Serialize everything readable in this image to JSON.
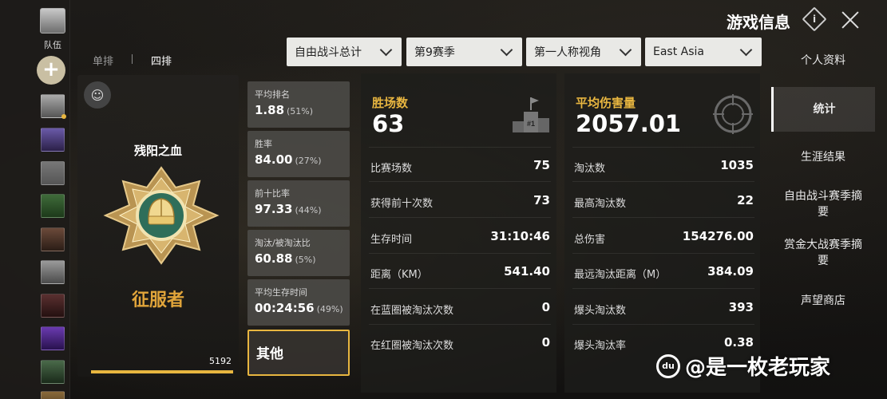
{
  "header": {
    "title": "游戏信息",
    "info_icon": "i",
    "close_icon": "close"
  },
  "left_column": {
    "team_label": "队伍",
    "add_label": "+"
  },
  "mode_tabs": [
    {
      "label": "单排",
      "active": false
    },
    {
      "label": "四排",
      "active": true
    }
  ],
  "filters": [
    {
      "value": "自由战斗总计"
    },
    {
      "value": "第9赛季"
    },
    {
      "value": "第一人称视角"
    },
    {
      "value": "East Asia"
    }
  ],
  "nav": [
    {
      "label": "个人资料",
      "active": false
    },
    {
      "label": "统计",
      "active": true
    },
    {
      "label": "生涯结果",
      "active": false
    },
    {
      "label": "自由战斗赛季摘要",
      "active": false
    },
    {
      "label": "赏金大战赛季摘要",
      "active": false
    },
    {
      "label": "声望商店",
      "active": false
    }
  ],
  "rank_card": {
    "player_name": "残阳之血",
    "rank_name": "征服者",
    "points": "5192",
    "progress": 1.0
  },
  "tiles": [
    {
      "label": "平均排名",
      "value": "1.88",
      "pct": "(51%)"
    },
    {
      "label": "胜率",
      "value": "84.00",
      "pct": "(27%)"
    },
    {
      "label": "前十比率",
      "value": "97.33",
      "pct": "(44%)"
    },
    {
      "label": "淘汰/被淘汰比",
      "value": "60.88",
      "pct": "(5%)"
    },
    {
      "label": "平均生存时间",
      "value": "00:24:56",
      "pct": "(49%)"
    }
  ],
  "other_tile": "其他",
  "panel_left": {
    "head_label": "胜场数",
    "head_value": "63",
    "icon_text": "#1",
    "rows": [
      {
        "label": "比赛场数",
        "value": "75"
      },
      {
        "label": "获得前十次数",
        "value": "73"
      },
      {
        "label": "生存时间",
        "value": "31:10:46"
      },
      {
        "label": "距离（KM）",
        "value": "541.40"
      },
      {
        "label": "在蓝圈被淘汰次数",
        "value": "0"
      },
      {
        "label": "在红圈被淘汰次数",
        "value": "0"
      }
    ]
  },
  "panel_right": {
    "head_label": "平均伤害量",
    "head_value": "2057.01",
    "rows": [
      {
        "label": "淘汰数",
        "value": "1035"
      },
      {
        "label": "最高淘汰数",
        "value": "22"
      },
      {
        "label": "总伤害",
        "value": "154276.00"
      },
      {
        "label": "最远淘汰距离（M）",
        "value": "384.09"
      },
      {
        "label": "爆头淘汰数",
        "value": "393"
      },
      {
        "label": "爆头淘汰率",
        "value": "0.38"
      }
    ]
  },
  "watermark": {
    "logo_text": "du",
    "text": "@是一枚老玩家"
  },
  "colors": {
    "accent": "#e8b640",
    "rank": "#e0a43a"
  }
}
